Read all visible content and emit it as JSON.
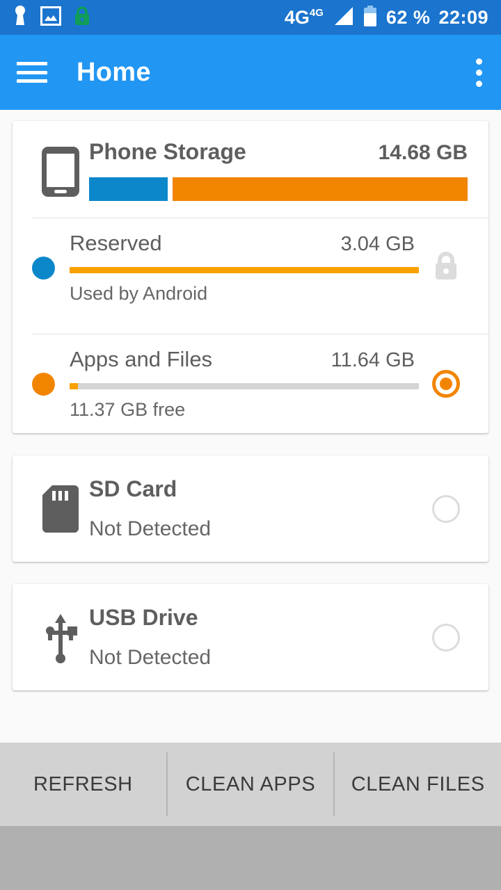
{
  "status_bar": {
    "icons": [
      "keyhole-icon",
      "image-icon",
      "lock-icon"
    ],
    "network": "4G",
    "network_sup": "4G",
    "battery_percent": "62 %",
    "time": "22:09",
    "background": "#1b74cd"
  },
  "app_bar": {
    "title": "Home",
    "menu_icon": "hamburger-icon",
    "overflow_icon": "more-vert-icon",
    "background": "#2196f3"
  },
  "phone_storage": {
    "icon": "phone-icon",
    "title": "Phone Storage",
    "total": "14.68 GB",
    "bar_segments": [
      {
        "name": "reserved",
        "percent": 20.7,
        "color": "#0c87ca"
      },
      {
        "name": "apps_and_files",
        "percent": 79.3,
        "color": "#f28500"
      }
    ],
    "rows": [
      {
        "dot_color": "#0c87ca",
        "title": "Reserved",
        "size": "3.04 GB",
        "progress_percent": 100,
        "caption": "Used by Android",
        "trailing": "lock-icon",
        "selected": false
      },
      {
        "dot_color": "#f28500",
        "title": "Apps and Files",
        "size": "11.64 GB",
        "progress_percent": 2.3,
        "caption": "11.37 GB free",
        "trailing": "radio-button",
        "selected": true
      }
    ]
  },
  "devices": [
    {
      "icon": "sd-card-icon",
      "title": "SD Card",
      "status": "Not Detected",
      "selected": false
    },
    {
      "icon": "usb-icon",
      "title": "USB Drive",
      "status": "Not Detected",
      "selected": false
    }
  ],
  "bottom_buttons": [
    {
      "label": "REFRESH"
    },
    {
      "label": "CLEAN APPS"
    },
    {
      "label": "CLEAN FILES"
    }
  ],
  "colors": {
    "accent_orange": "#f28500",
    "accent_blue": "#0c87ca",
    "page_background": "#fafafa",
    "button_bar": "#d2d2d2"
  }
}
